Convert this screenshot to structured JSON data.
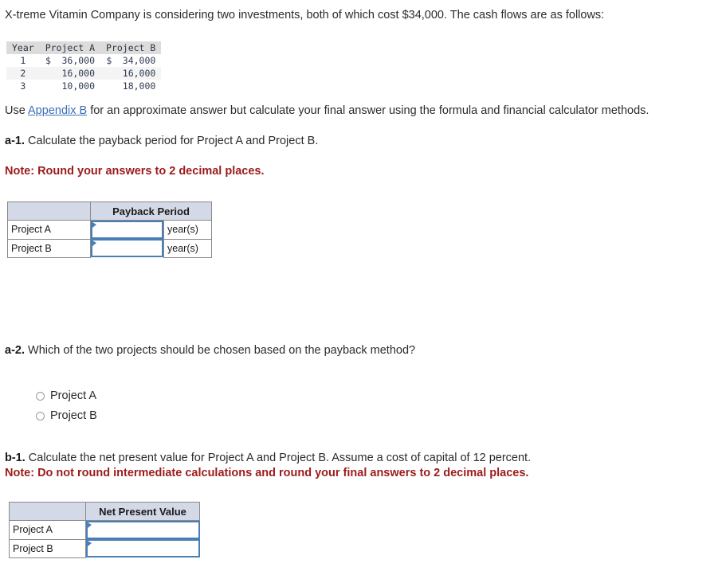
{
  "intro": {
    "text": "X-treme Vitamin Company is considering two investments, both of which cost $34,000. The cash flows are as follows:"
  },
  "cashflow_table": {
    "headers": [
      "Year",
      "Project A",
      "Project B"
    ],
    "rows": [
      {
        "year": "1",
        "a_currency": "$",
        "a_amount": "36,000",
        "b_currency": "$",
        "b_amount": "34,000"
      },
      {
        "year": "2",
        "a_currency": "",
        "a_amount": "16,000",
        "b_currency": "",
        "b_amount": "16,000"
      },
      {
        "year": "3",
        "a_currency": "",
        "a_amount": "10,000",
        "b_currency": "",
        "b_amount": "18,000"
      }
    ]
  },
  "appendix_line": {
    "prefix": "Use ",
    "link_text": "Appendix B",
    "suffix": " for an approximate answer but calculate your final answer using the formula and financial calculator methods."
  },
  "a1": {
    "label": "a-1.",
    "text": " Calculate the payback period for Project A and Project B.",
    "note": "Note: Round your answers to 2 decimal places."
  },
  "payback_table": {
    "corner": "",
    "column_header": "Payback Period",
    "rows": [
      {
        "label": "Project A",
        "value": "",
        "unit": "year(s)"
      },
      {
        "label": "Project B",
        "value": "",
        "unit": "year(s)"
      }
    ]
  },
  "a2": {
    "label": "a-2.",
    "text": " Which of the two projects should be chosen based on the payback method?",
    "options": [
      {
        "label": "Project A",
        "selected": false
      },
      {
        "label": "Project B",
        "selected": false
      }
    ]
  },
  "b1": {
    "label": "b-1.",
    "text": " Calculate the net present value for Project A and Project B. Assume a cost of capital of 12 percent.",
    "note": "Note: Do not round intermediate calculations and round your final answers to 2 decimal places."
  },
  "npv_table": {
    "corner": "",
    "column_header": "Net Present Value",
    "rows": [
      {
        "label": "Project A",
        "value": ""
      },
      {
        "label": "Project B",
        "value": ""
      }
    ]
  },
  "colors": {
    "link": "#3c6fb5",
    "note": "#9b1b1b",
    "input_border": "#4a7fb5",
    "header_fill": "#d3d9e6",
    "data_header_fill": "#dcdcdc"
  }
}
